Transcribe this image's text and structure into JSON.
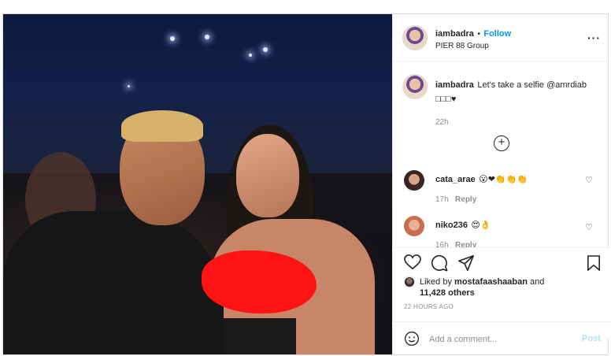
{
  "header": {
    "username": "iambadra",
    "separator": "•",
    "follow_label": "Follow",
    "location": "PIER 88 Group",
    "more_label": "···"
  },
  "caption": {
    "username": "iambadra",
    "text": "Let's take a selfie @amrdiab □□□♥",
    "time": "22h"
  },
  "load_more_icon": "plus-circle-icon",
  "comments": [
    {
      "username": "cata_arae",
      "text": "😮❤👏👏👏",
      "time": "17h",
      "reply_label": "Reply"
    },
    {
      "username": "niko236",
      "text": "😍👌",
      "time": "16h",
      "reply_label": "Reply"
    }
  ],
  "actions": {
    "icons": [
      "heart-icon",
      "comment-icon",
      "share-icon",
      "bookmark-icon"
    ]
  },
  "likes": {
    "prefix": "Liked by",
    "user": "mostafaashaaban",
    "and": "and",
    "count": "11,428 others"
  },
  "timestamp": "22 HOURS AGO",
  "add_comment": {
    "placeholder": "Add a comment...",
    "post_label": "Post"
  },
  "colors": {
    "follow": "#0095f6",
    "post_disabled": "#b2dffc",
    "redaction": "#ff1313"
  }
}
